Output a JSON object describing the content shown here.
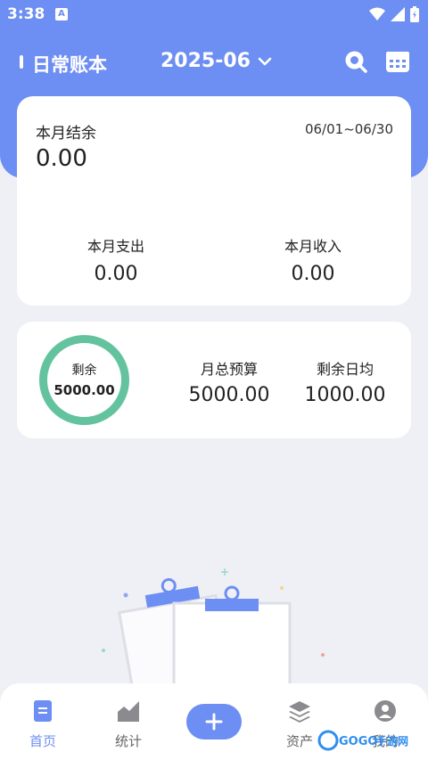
{
  "status_bar": {
    "time": "3:38",
    "notification_letter": "A"
  },
  "header": {
    "book_title": "日常账本",
    "month": "2025-06"
  },
  "summary": {
    "balance_label": "本月结余",
    "balance_value": "0.00",
    "date_range": "06/01~06/30",
    "expense_label": "本月支出",
    "expense_value": "0.00",
    "income_label": "本月收入",
    "income_value": "0.00"
  },
  "budget": {
    "remaining_label": "剩余",
    "remaining_value": "5000.00",
    "total_label": "月总预算",
    "total_value": "5000.00",
    "daily_label": "剩余日均",
    "daily_value": "1000.00",
    "remaining_fraction": 1.0
  },
  "tabs": [
    {
      "label": "首页",
      "active": true
    },
    {
      "label": "统计",
      "active": false
    },
    {
      "label": "资产",
      "active": false
    },
    {
      "label": "我的",
      "active": false
    }
  ],
  "watermark": {
    "brand": "GOGO",
    "suffix": "手游网"
  },
  "colors": {
    "primary": "#6d8ef2",
    "ring": "#63c39e",
    "background": "#eff0f5"
  }
}
